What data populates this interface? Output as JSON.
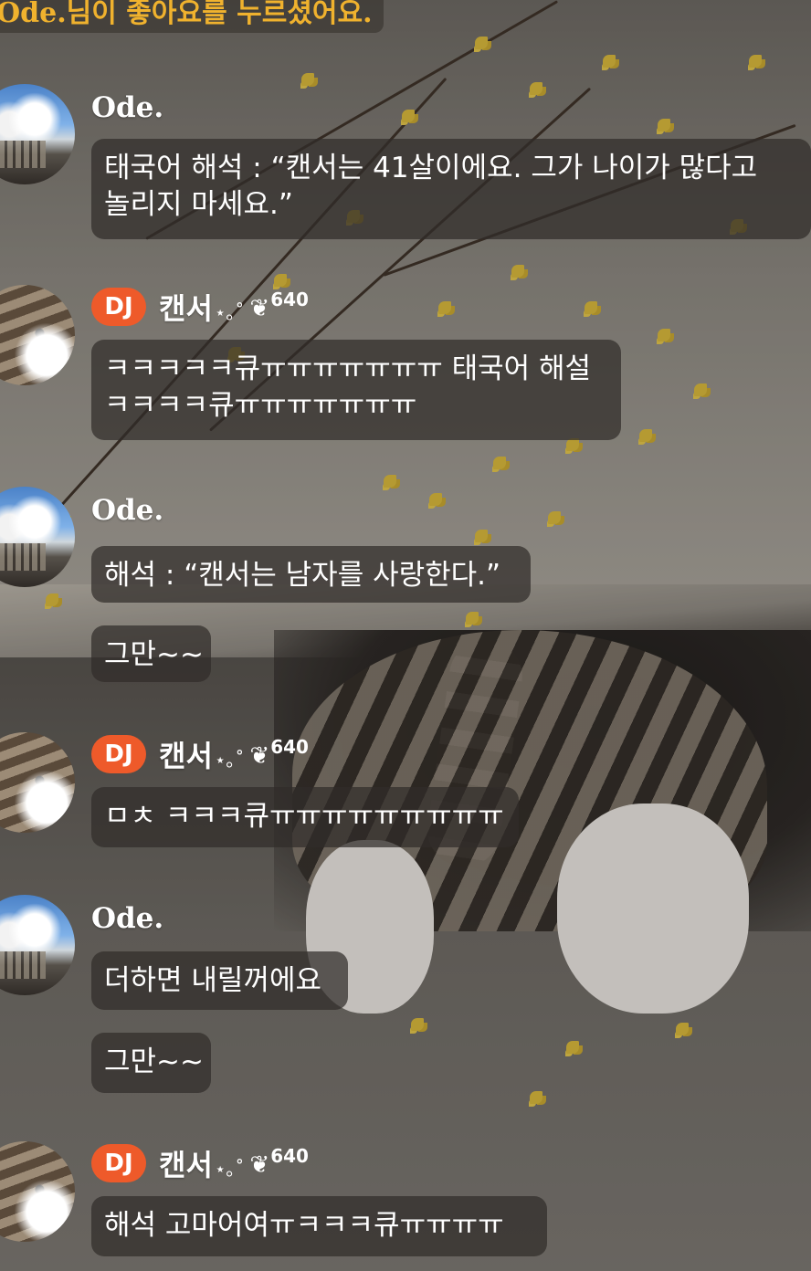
{
  "notification": {
    "text": "Ode.님이 좋아요를 누르셨어요."
  },
  "messages": [
    {
      "sender": "Ode.",
      "dj": false,
      "avatar": "sky-building-avatar",
      "bubbles": [
        "태국어 해석 : “캔서는 41살이에요. 그가 나이가 많다고",
        "놀리지 마세요.”"
      ]
    },
    {
      "sender": "캔서",
      "dj": true,
      "dj_label": "DJ",
      "decoration": "⋆｡˚",
      "heart_icon": "heart-ribbon-icon",
      "heart_glyph": "❦",
      "fan_count": "640",
      "avatar": "cat-avatar",
      "bubbles": [
        "ㅋㅋㅋㅋㅋ큐ㅠㅠㅠㅠㅠㅠㅠ 태국어 해설",
        "ㅋㅋㅋㅋ큐ㅠㅠㅠㅠㅠㅠㅠ"
      ]
    },
    {
      "sender": "Ode.",
      "dj": false,
      "avatar": "sky-building-avatar",
      "bubbles": [
        "해석 : “캔서는 남자를 사랑한다.”",
        "그만~~"
      ]
    },
    {
      "sender": "캔서",
      "dj": true,
      "dj_label": "DJ",
      "decoration": "⋆｡˚",
      "heart_glyph": "❦",
      "fan_count": "640",
      "avatar": "cat-avatar",
      "bubbles": [
        "ㅁㅊ ㅋㅋㅋ큐ㅠㅠㅠㅠㅠㅠㅠㅠㅠ"
      ]
    },
    {
      "sender": "Ode.",
      "dj": false,
      "avatar": "sky-building-avatar",
      "bubbles": [
        "더하면 내릴꺼에요",
        "그만~~"
      ]
    },
    {
      "sender": "캔서",
      "dj": true,
      "dj_label": "DJ",
      "decoration": "⋆｡˚",
      "heart_glyph": "❦",
      "fan_count": "640",
      "avatar": "cat-avatar",
      "bubbles": [
        "해석 고마어여ㅠㅋㅋㅋ큐ㅠㅠㅠㅠ"
      ]
    }
  ],
  "colors": {
    "notification_text": "#f0b22e",
    "dj_badge": "#ee5a2a",
    "bubble_bg": "rgba(48,45,42,0.72)",
    "text": "#ffffff"
  }
}
